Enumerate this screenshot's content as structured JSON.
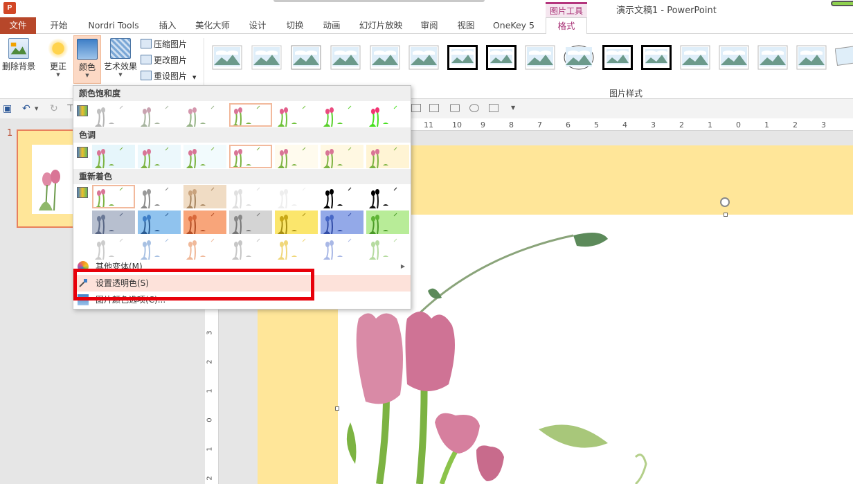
{
  "window": {
    "title": "演示文稿1 - PowerPoint",
    "app_icon": "P",
    "context_tab": "图片工具"
  },
  "tabs": [
    {
      "label": "文件"
    },
    {
      "label": "开始"
    },
    {
      "label": "Nordri Tools"
    },
    {
      "label": "插入"
    },
    {
      "label": "美化大师"
    },
    {
      "label": "设计"
    },
    {
      "label": "切换"
    },
    {
      "label": "动画"
    },
    {
      "label": "幻灯片放映"
    },
    {
      "label": "审阅"
    },
    {
      "label": "视图"
    },
    {
      "label": "OneKey 5"
    },
    {
      "label": "格式"
    }
  ],
  "ribbon": {
    "remove_bg": "删除背景",
    "corrections": "更正",
    "color": "颜色",
    "artistic": "艺术效果",
    "compress": "压缩图片",
    "change": "更改图片",
    "reset": "重设图片",
    "group_label": "图片样式"
  },
  "dropdown": {
    "saturation_header": "颜色饱和度",
    "tone_header": "色调",
    "recolor_header": "重新着色",
    "more_variants": "其他变体(M)",
    "set_transparent": "设置透明色(S)",
    "picture_options": "图片颜色选项(C)..."
  },
  "slide_pane": {
    "slide_number": "1"
  },
  "ruler": {
    "marks": [
      "11",
      "10",
      "9",
      "8",
      "7",
      "6",
      "5",
      "4",
      "3",
      "2",
      "1",
      "0",
      "1",
      "2",
      "3"
    ],
    "vmarks": [
      "3",
      "2",
      "1",
      "0",
      "1",
      "2"
    ]
  },
  "colors": {
    "file_tab": "#b7472a",
    "format_tab": "#a62d73",
    "slide_bg": "#ffe699",
    "highlight": "#e8000a"
  }
}
